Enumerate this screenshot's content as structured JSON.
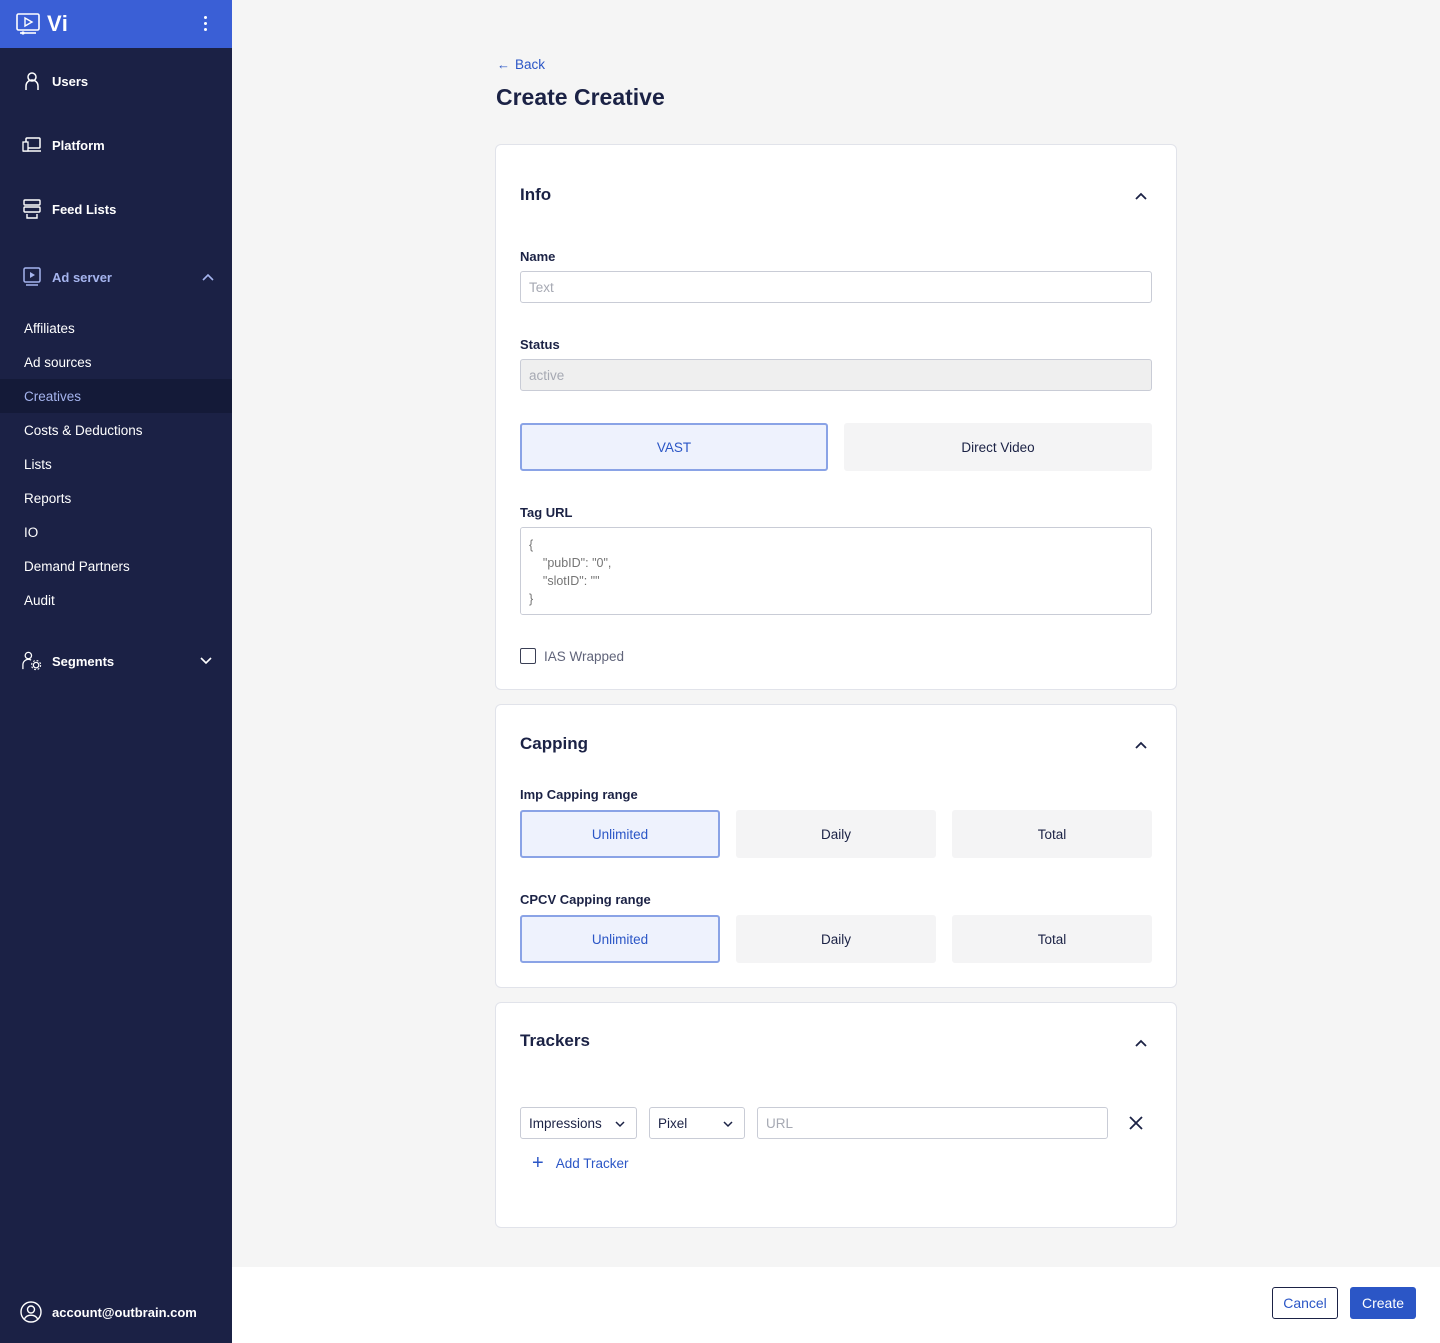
{
  "app": {
    "brand": "Vi"
  },
  "sidebar": {
    "nav": {
      "users": "Users",
      "platform": "Platform",
      "feed_lists": "Feed Lists",
      "ad_server": "Ad server",
      "segments": "Segments"
    },
    "ad_server_items": [
      "Affiliates",
      "Ad sources",
      "Creatives",
      "Costs & Deductions",
      "Lists",
      "Reports",
      "IO",
      "Demand Partners",
      "Audit"
    ],
    "active_item": "Creatives",
    "account": "account@outbrain.com"
  },
  "page": {
    "back_label": "Back",
    "title": "Create Creative"
  },
  "info": {
    "title": "Info",
    "name_label": "Name",
    "name_placeholder": "Text",
    "status_label": "Status",
    "status_value": "active",
    "type_options": [
      "VAST",
      "Direct Video"
    ],
    "type_selected": "VAST",
    "tag_url_label": "Tag URL",
    "tag_url_placeholder": "{\n    \"pubID\": \"0\",\n    \"slotID\": \"\"\n}",
    "ias_label": "IAS Wrapped",
    "ias_checked": false
  },
  "capping": {
    "title": "Capping",
    "imp_label": "Imp Capping range",
    "imp_options": [
      "Unlimited",
      "Daily",
      "Total"
    ],
    "imp_selected": "Unlimited",
    "cpcv_label": "CPCV Capping range",
    "cpcv_options": [
      "Unlimited",
      "Daily",
      "Total"
    ],
    "cpcv_selected": "Unlimited"
  },
  "trackers": {
    "title": "Trackers",
    "event_value": "Impressions",
    "kind_value": "Pixel",
    "url_placeholder": "URL",
    "add_label": "Add Tracker"
  },
  "footer": {
    "cancel_label": "Cancel",
    "create_label": "Create"
  },
  "colors": {
    "sidebar_bg": "#1b2145",
    "brand_bg": "#3a5fd6",
    "accent": "#2b56c6",
    "selected_bg": "#eef2fd"
  }
}
